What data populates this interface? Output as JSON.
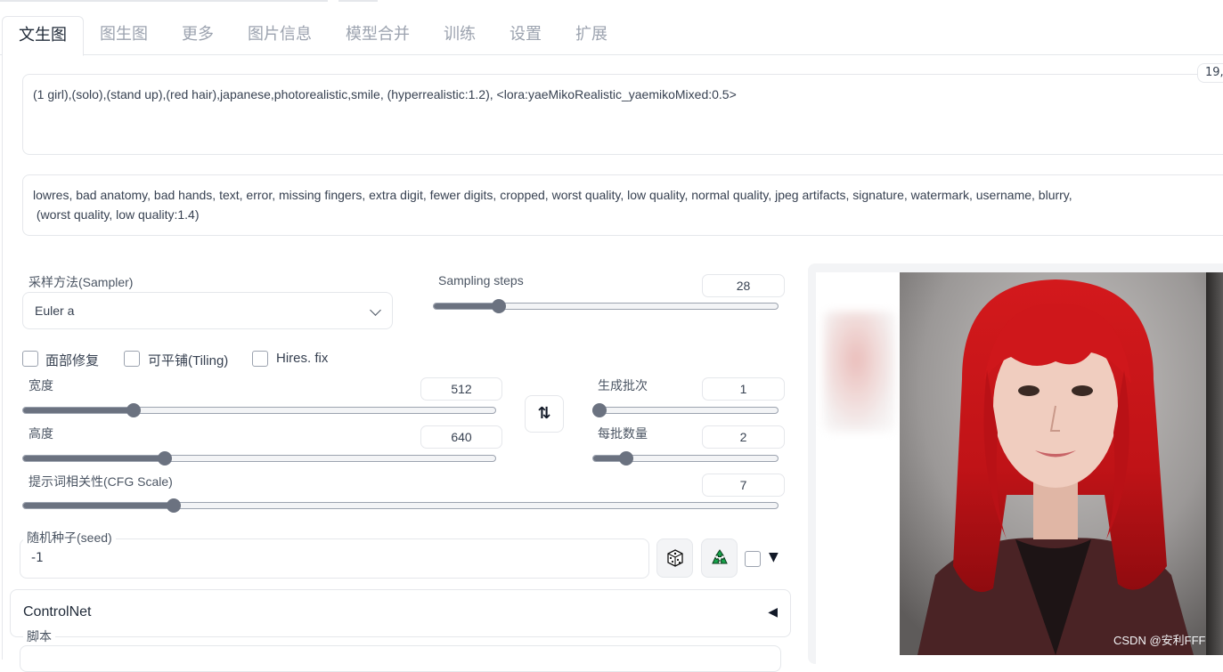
{
  "tabs": [
    {
      "label": "文生图",
      "active": true
    },
    {
      "label": "图生图"
    },
    {
      "label": "更多"
    },
    {
      "label": "图片信息"
    },
    {
      "label": "模型合并"
    },
    {
      "label": "训练"
    },
    {
      "label": "设置"
    },
    {
      "label": "扩展"
    }
  ],
  "prompt": {
    "positive": "(1 girl),(solo),(stand up),(red hair),japanese,photorealistic,smile, (hyperrealistic:1.2), <lora:yaeMikoRealistic_yaemikoMixed:0.5>",
    "negative_line1": "lowres, bad anatomy, bad hands, text, error, missing fingers, extra digit, fewer digits, cropped, worst quality, low quality, normal quality, jpeg artifacts, signature, watermark, username, blurry,",
    "negative_line2": " (worst quality, low quality:1.4)",
    "token_count": "19,"
  },
  "sampler": {
    "label": "采样方法(Sampler)",
    "value": "Euler a"
  },
  "steps": {
    "label": "Sampling steps",
    "value": "28",
    "fraction": 0.19
  },
  "checkboxes": {
    "restore_faces": "面部修复",
    "tiling": "可平铺(Tiling)",
    "hires_fix": "Hires. fix"
  },
  "width": {
    "label": "宽度",
    "value": "512",
    "fraction": 0.235
  },
  "height": {
    "label": "高度",
    "value": "640",
    "fraction": 0.3
  },
  "batch_count": {
    "label": "生成批次",
    "value": "1",
    "fraction": 0.0
  },
  "batch_size": {
    "label": "每批数量",
    "value": "2",
    "fraction": 0.18
  },
  "cfg": {
    "label": "提示词相关性(CFG Scale)",
    "value": "7",
    "fraction": 0.2
  },
  "seed": {
    "label": "随机种子(seed)",
    "value": "-1"
  },
  "icons": {
    "swap": "swap-dimensions-icon",
    "dice": "dice-icon",
    "recycle": "recycle-icon",
    "extra": "disclosure-triangle-icon"
  },
  "symbols": {
    "swap": "⇅",
    "caret_down": "▼",
    "caret_left": "◀"
  },
  "controlnet": {
    "title": "ControlNet"
  },
  "script": {
    "label": "脚本"
  },
  "output": {
    "watermark": "CSDN @安利FFF"
  }
}
